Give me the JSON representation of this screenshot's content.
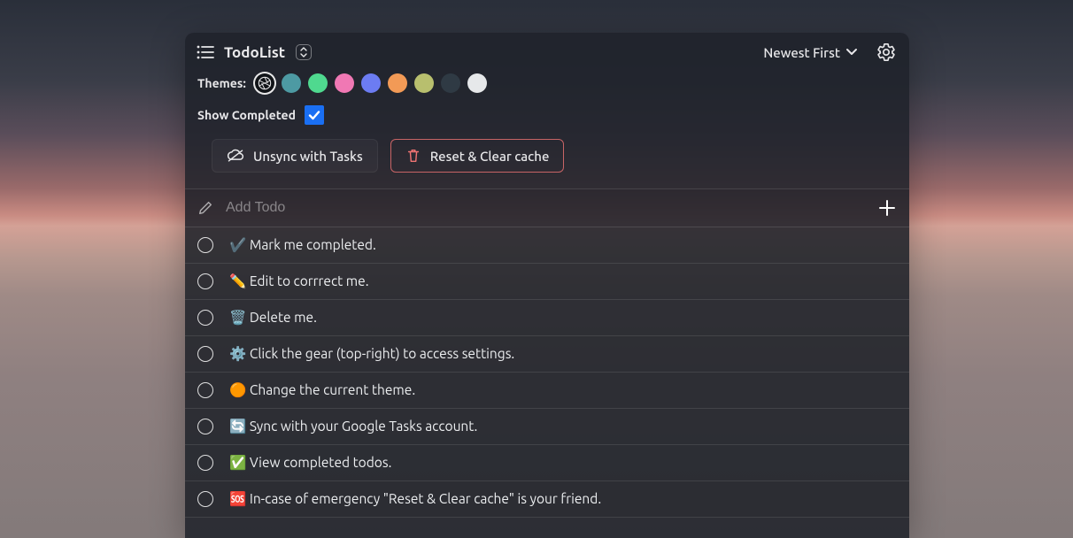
{
  "header": {
    "title": "TodoList",
    "sort_label": "Newest First"
  },
  "settings": {
    "themes_label": "Themes:",
    "theme_colors": [
      "#4d9aa3",
      "#4fd98f",
      "#f078b4",
      "#6c7cf2",
      "#f29a56",
      "#b8bf6e",
      "#2f3a44",
      "#e6e8ea"
    ],
    "show_completed_label": "Show Completed",
    "show_completed": true,
    "unsync_label": "Unsync with Tasks",
    "reset_label": "Reset & Clear cache"
  },
  "add": {
    "placeholder": "Add Todo"
  },
  "todos": [
    {
      "text": "✔️ Mark me completed."
    },
    {
      "text": "✏️ Edit to corrrect me."
    },
    {
      "text": "🗑️ Delete me."
    },
    {
      "text": "⚙️ Click the gear (top-right) to access settings."
    },
    {
      "text": "🟠 Change the current theme."
    },
    {
      "text": "🔄 Sync with your Google Tasks account."
    },
    {
      "text": "✅ View completed todos."
    },
    {
      "text": "🆘 In-case of emergency \"Reset & Clear cache\" is your friend."
    }
  ]
}
